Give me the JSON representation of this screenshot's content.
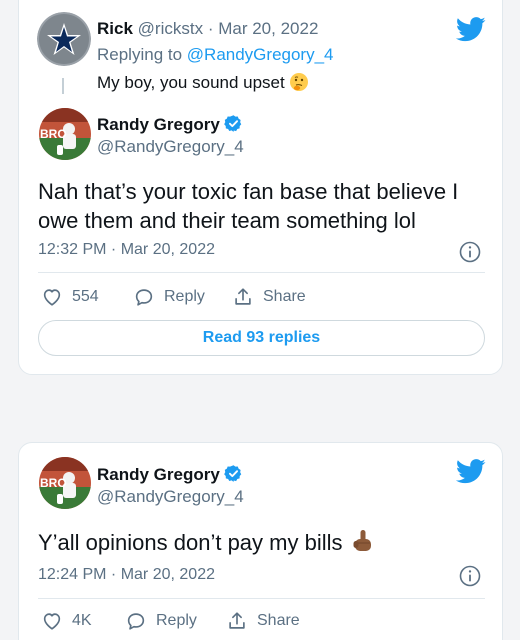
{
  "tweet1": {
    "parent": {
      "name": "Rick",
      "handle": "@rickstx",
      "date": "Mar 20, 2022",
      "replying_prefix": "Replying to ",
      "replying_to": "@RandyGregory_4",
      "text": "My boy, you sound upset",
      "emoji_icon": "thinking-face-icon"
    },
    "name": "Randy Gregory",
    "handle": "@RandyGregory_4",
    "text_line1": "Nah that’s your toxic fan base that believe I",
    "text_line2": "owe them and their team something lol",
    "timestamp": "12:32 PM · Mar 20, 2022",
    "likes": "554",
    "reply_label": "Reply",
    "share_label": "Share",
    "read_replies_label": "Read 93 replies"
  },
  "tweet2": {
    "name": "Randy Gregory",
    "handle": "@RandyGregory_4",
    "text": "Y’all opinions don’t pay my bills",
    "emoji_icon": "middle-finger-icon",
    "timestamp": "12:24 PM · Mar 20, 2022",
    "likes": "4K",
    "reply_label": "Reply",
    "share_label": "Share"
  },
  "colors": {
    "twitter_blue": "#1d9bf0",
    "text_gray": "#5b7083",
    "page_background": "#f3f4f6"
  }
}
